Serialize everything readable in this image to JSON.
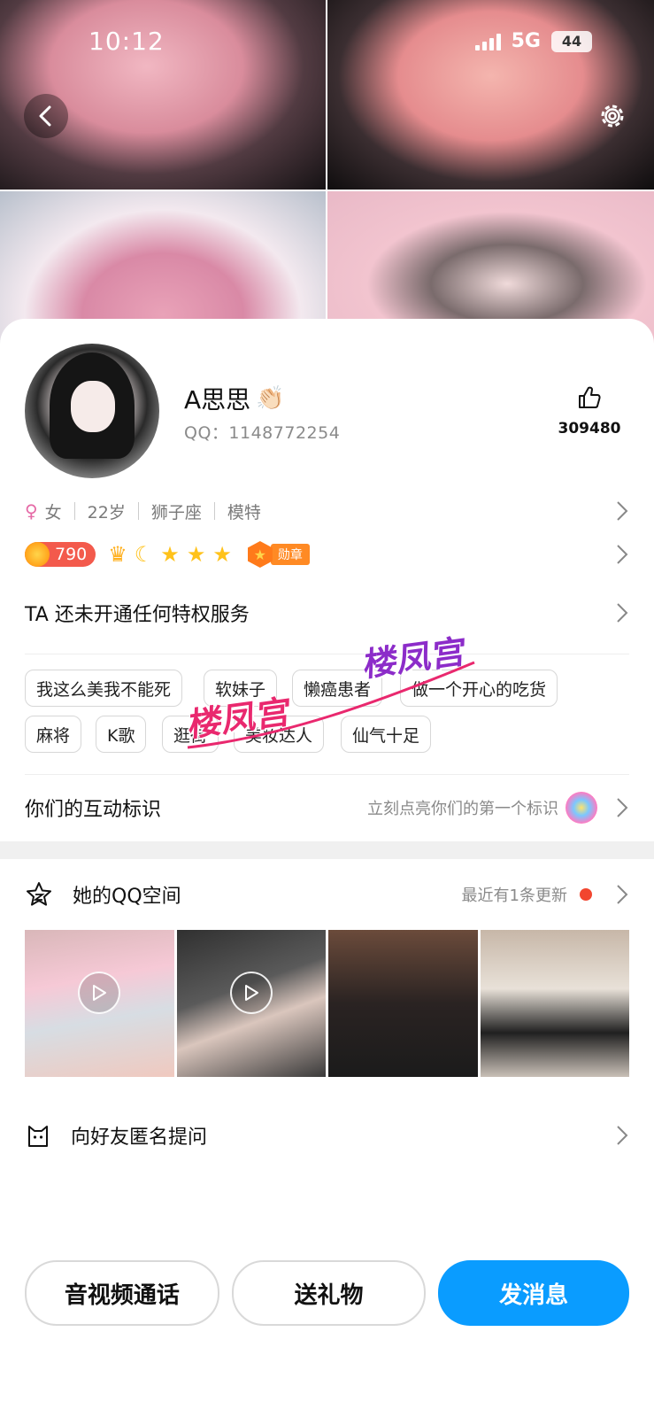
{
  "status_bar": {
    "time": "10:12",
    "network": "5G",
    "battery": "44"
  },
  "profile": {
    "name": "A思思",
    "name_emoji": "👏🏻",
    "qq_label": "QQ：1148772254",
    "likes": "309480",
    "gender_symbol": "♀",
    "gender": "女",
    "age": "22岁",
    "zodiac": "狮子座",
    "occupation": "模特"
  },
  "badges": {
    "coin_value": "790",
    "medal_label": "勋章"
  },
  "privilege_text": "TA 还未开通任何特权服务",
  "tags": [
    "我这么美我不能死",
    "软妹子",
    "懒癌患者",
    "做一个开心的吃货",
    "麻将",
    "K歌",
    "逛街",
    "美妆达人",
    "仙气十足"
  ],
  "watermark": "楼凤宫",
  "interaction": {
    "label": "你们的互动标识",
    "hint": "立刻点亮你们的第一个标识"
  },
  "qzone": {
    "label": "她的QQ空间",
    "hint": "最近有1条更新"
  },
  "ask": {
    "label": "向好友匿名提问"
  },
  "actions": {
    "call": "音视频通话",
    "gift": "送礼物",
    "message": "发消息"
  },
  "colors": {
    "primary": "#0a9cff",
    "coin_pill": "#f35a4c",
    "unread_dot": "#f2462f"
  },
  "icons": [
    "back-icon",
    "gear-icon",
    "thumb-up-icon",
    "chevron-right-icon",
    "coin-icon",
    "crown-icon",
    "moon-icon",
    "star-icon",
    "medal-icon",
    "flower-icon",
    "qzone-star-icon",
    "play-icon",
    "cat-icon"
  ]
}
